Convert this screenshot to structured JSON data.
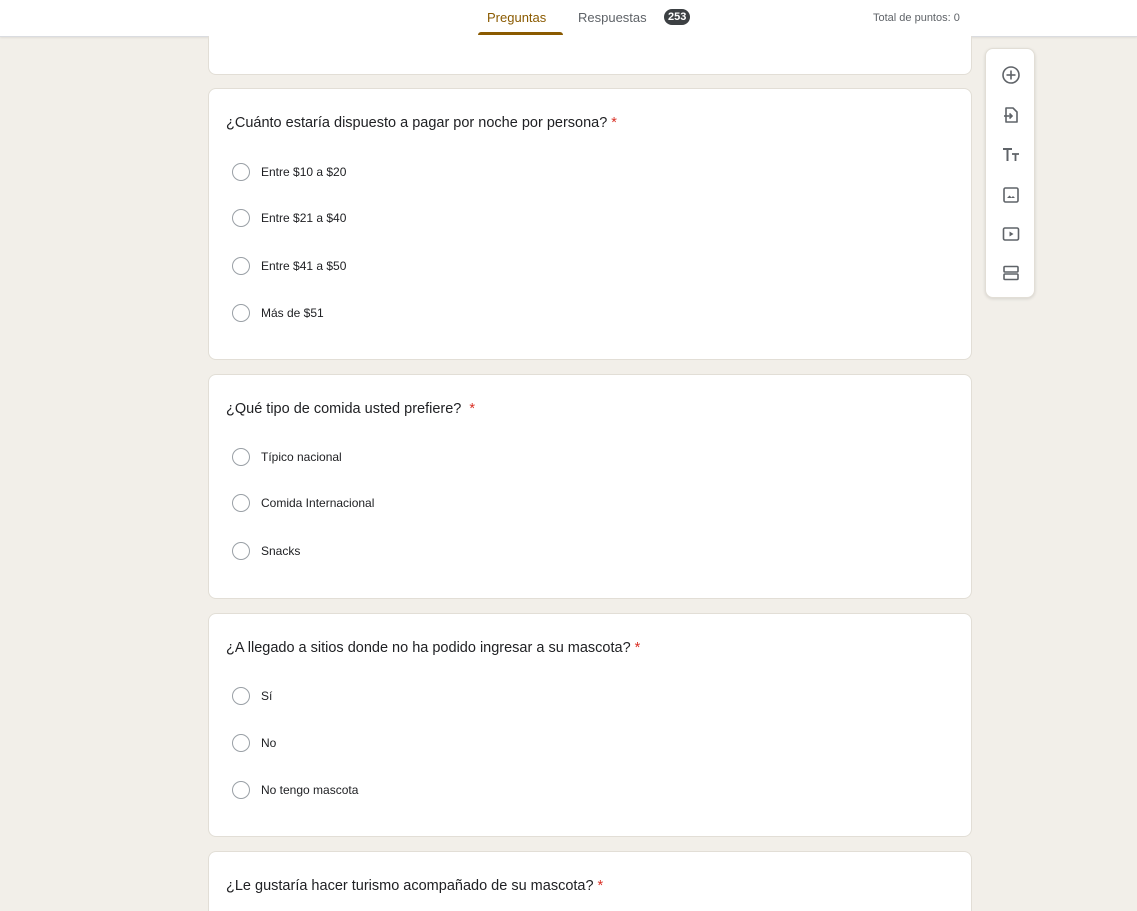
{
  "header": {
    "tabs": [
      {
        "label": "Preguntas",
        "active": true
      },
      {
        "label": "Respuestas",
        "active": false
      }
    ],
    "responses_count": "253",
    "total_points": "Total de puntos: 0"
  },
  "questions": [
    {
      "title": "¿Cuánto estaría dispuesto a pagar por noche por persona?",
      "required": "*",
      "options": [
        "Entre  $10 a $20",
        "Entre $21 a $40",
        "Entre $41 a $50",
        "Más de $51"
      ]
    },
    {
      "title": "¿Qué tipo de comida usted prefiere?",
      "required": "*",
      "options": [
        "Típico nacional",
        "Comida Internacional",
        "Snacks"
      ]
    },
    {
      "title": "¿A llegado a sitios donde no ha podido ingresar a su mascota?",
      "required": "*",
      "options": [
        "Sí",
        "No",
        "No tengo mascota"
      ]
    },
    {
      "title": "¿Le gustaría hacer turismo acompañado de su mascota?",
      "required": "*",
      "options": []
    }
  ],
  "toolbar": {
    "icons": [
      "add-question-icon",
      "import-questions-icon",
      "add-title-icon",
      "add-image-icon",
      "add-video-icon",
      "add-section-icon"
    ]
  },
  "colors": {
    "accent": "#8a5a00",
    "background": "#f2efe9",
    "required": "#d93025"
  }
}
